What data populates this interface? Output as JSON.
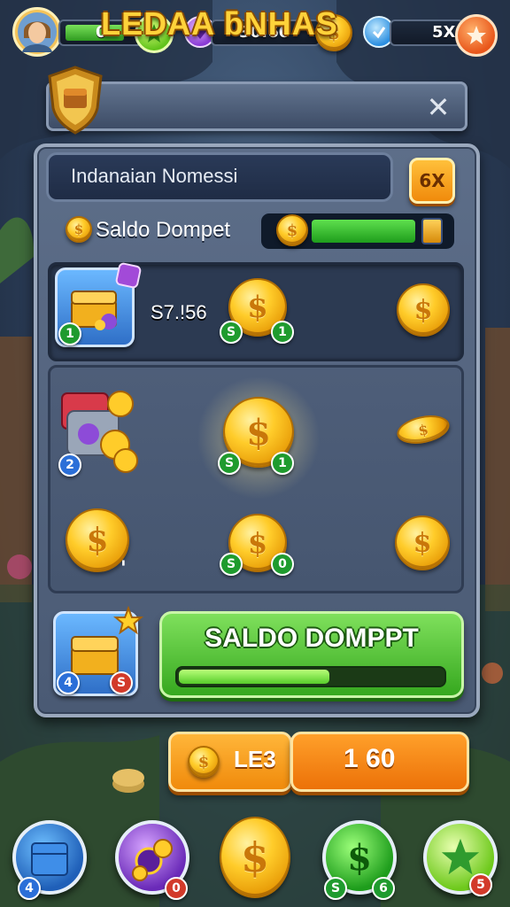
{
  "hud": {
    "level_value": "0",
    "gem_value": "30:60",
    "multiplier_value": "5X"
  },
  "banner": {
    "title": "LEDAA ƃNHAS"
  },
  "panel": {
    "name_field": "Indanaian Nomessi",
    "corner_button": "6X",
    "saldo_label": "Saldo Dompet",
    "wallet_fill_fraction": 0.78,
    "row1": {
      "price": "S7.!56",
      "badge_left": "1",
      "coin_badge_a": "S",
      "coin_badge_b": "1"
    },
    "row2": {
      "badge_left": "2",
      "coin_badge_a": "S",
      "coin_badge_b": "1"
    },
    "row3": {
      "coin_badge_a": "S",
      "coin_badge_b": "0"
    },
    "bottom": {
      "chest_badge_a": "4",
      "chest_badge_b": "S",
      "button_label": "SALDO DOMPPT",
      "progress_fraction": 0.57
    }
  },
  "currency_bar": {
    "left_label": "LE3",
    "right_value": "1 60"
  },
  "nav": {
    "item1_badge": "4",
    "item2_badge": "0",
    "item4_badge_a": "S",
    "item4_badge_b": "6",
    "item5_badge": "5"
  },
  "colors": {
    "accent_gold": "#ffd23a",
    "action_green": "#36a81f",
    "action_orange": "#f08a0b",
    "panel_slate": "#4a5a74"
  }
}
